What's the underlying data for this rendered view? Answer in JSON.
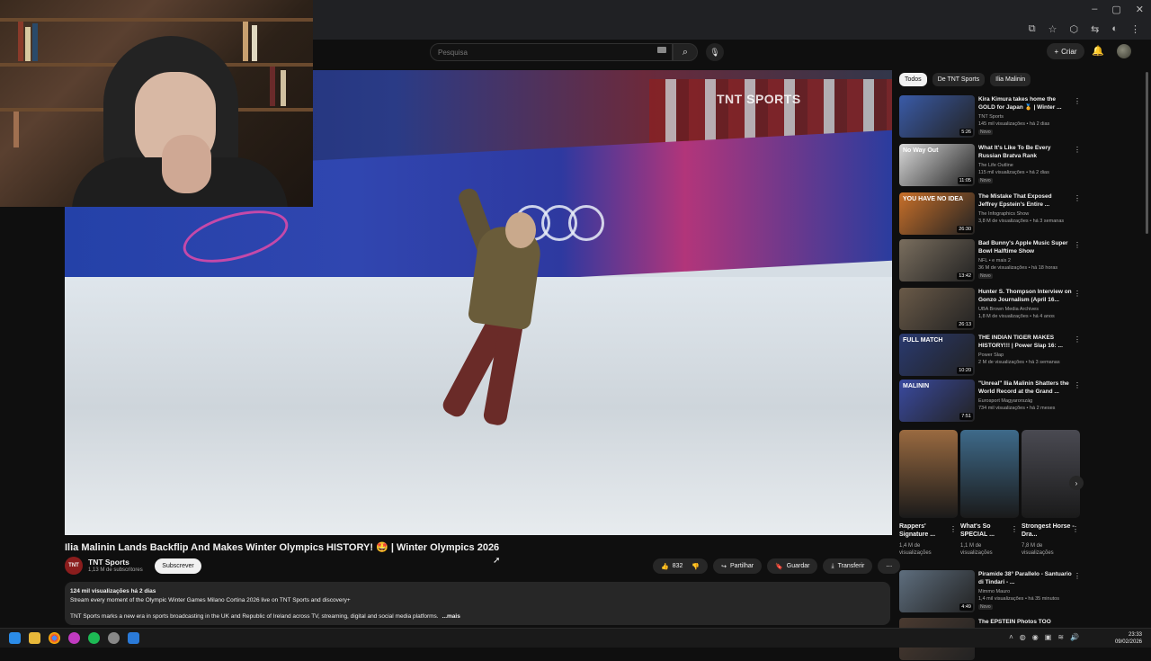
{
  "browser": {
    "window_controls": [
      "–",
      "▢",
      "✕"
    ]
  },
  "search": {
    "placeholder": "Pesquisa"
  },
  "header": {
    "create_label": "Criar"
  },
  "video": {
    "watermark": "TNT SPORTS",
    "title": "Ilia Malinin Lands Backflip And Makes Winter Olympics HISTORY! 🤩 | Winter Olympics 2026",
    "channel_avatar_text": "TNT",
    "channel_name": "TNT Sports",
    "subscriber_count": "1,13 M de subscritores",
    "subscribe_label": "Subscrever",
    "like_count": "832",
    "share_label": "Partilhar",
    "save_label": "Guardar",
    "download_label": "Transferir",
    "description_meta": "124 mil visualizações  há 2 dias",
    "description_line1": "Stream every moment of the Olympic Winter Games Milano Cortina 2026 live on TNT Sports and discovery+ ",
    "description_line2": "TNT Sports marks a new era in sports broadcasting in the UK and Republic of Ireland across TV, streaming, digital and social media platforms.",
    "description_more": "...mais"
  },
  "chips": [
    "Todos",
    "De TNT Sports",
    "Ilia Malinin"
  ],
  "recommendations": [
    {
      "title": "Kira Kimura takes home the GOLD for Japan 🏅 | Winter ...",
      "channel": "TNT Sports",
      "meta": "145 mil visualizações • há 2 dias",
      "badge": "Novo",
      "duration": "5:26",
      "color": "#3a5ba8"
    },
    {
      "title": "What It's Like To Be Every Russian Bratva Rank",
      "channel": "The Life Outline",
      "meta": "115 mil visualizações • há 2 dias",
      "badge": "Novo",
      "duration": "11:05",
      "color": "#d9d9d9",
      "thumb_text": "No Way Out"
    },
    {
      "title": "The Mistake That Exposed Jeffrey Epstein's Entire ...",
      "channel": "The Infographics Show",
      "meta": "3,8 M de visualizações • há 3 semanas",
      "badge": "",
      "duration": "26:30",
      "color": "#c8702a",
      "thumb_text": "YOU HAVE NO IDEA"
    },
    {
      "title": "Bad Bunny's Apple Music Super Bowl Halftime Show",
      "channel": "NFL • e mais 2",
      "meta": "36 M de visualizações • há 18 horas",
      "badge": "Novo",
      "duration": "13:42",
      "color": "#7a6e5e"
    },
    {
      "title": "Hunter S. Thompson Interview on Gonzo Journalism (April 16...",
      "channel": "UBA Brown Media Archives",
      "meta": "1,8 M de visualizações • há 4 anos",
      "badge": "",
      "duration": "26:13",
      "color": "#6a5a48"
    },
    {
      "title": "THE INDIAN TIGER MAKES HISTORY!!! | Power Slap 16: ...",
      "channel": "Power Slap",
      "meta": "2 M de visualizações • há 3 semanas",
      "badge": "",
      "duration": "10:20",
      "color": "#2a3a70",
      "thumb_text": "FULL MATCH"
    },
    {
      "title": "\"Unreal\" Ilia Malinin Shatters the World Record at the Grand ...",
      "channel": "Eurosport Magyarország",
      "meta": "734 mil visualizações • há 2 meses",
      "badge": "",
      "duration": "7:51",
      "color": "#3a4aa0",
      "thumb_text": "MALININ"
    },
    {
      "title": "Piramide 38° Parallelo - Santuario di Tindari - ...",
      "channel": "Mimmo Mauro",
      "meta": "1,4 mil visualizações • há 35 minutos",
      "badge": "Novo",
      "duration": "4:49",
      "color": "#5e6e7e"
    },
    {
      "title": "The EPSTEIN Photos TOO",
      "channel": "",
      "meta": "",
      "badge": "",
      "duration": "",
      "color": "#4a3a30"
    }
  ],
  "shorts": [
    {
      "title": "Rappers' Signature ...",
      "views": "1,4 M de visualizações",
      "color": "#9a6a40"
    },
    {
      "title": "What's So SPECIAL ...",
      "views": "1,1 M de visualizações",
      "color": "#3e6a8a"
    },
    {
      "title": "Strongest Horse - Dra...",
      "views": "7,8 M de visualizações",
      "color": "#4a4a52"
    }
  ],
  "taskbar": {
    "time": "23:33",
    "date": "09/02/2026"
  }
}
